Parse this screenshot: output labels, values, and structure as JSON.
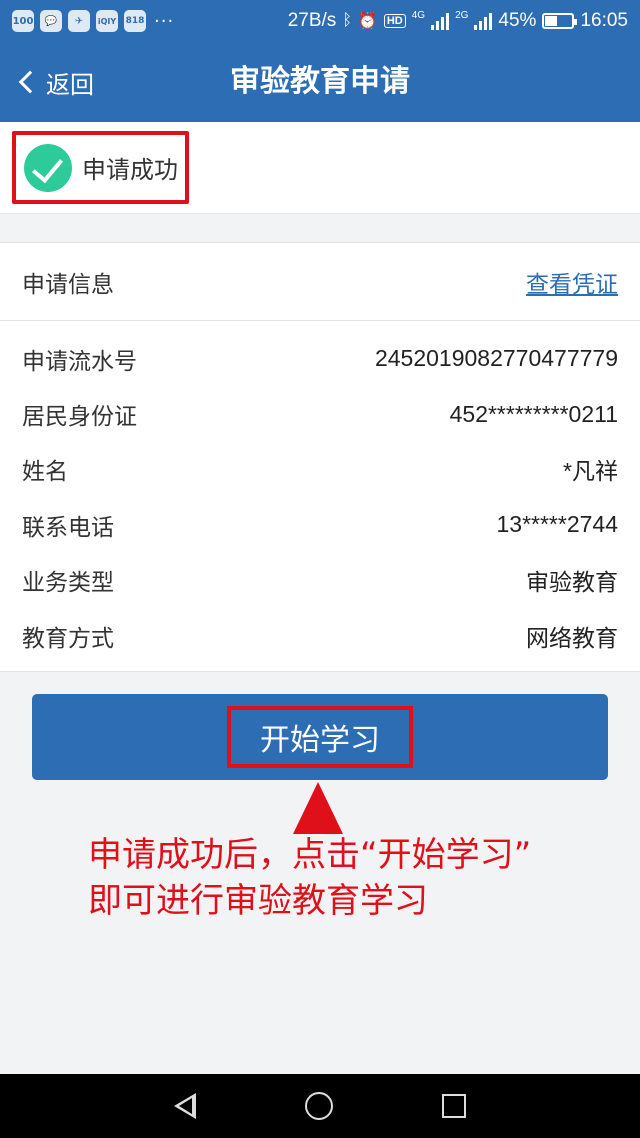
{
  "status_bar": {
    "apps": [
      "100",
      "💬",
      "✈",
      "iQIY",
      "818"
    ],
    "more": "···",
    "net_speed": "27B/s",
    "hd": "HD",
    "net1": "4G",
    "net2": "2G",
    "battery": "45%",
    "battery_level": 0.45,
    "time": "16:05"
  },
  "nav": {
    "back_label": "返回",
    "title": "审验教育申请"
  },
  "success": {
    "text": "申请成功"
  },
  "info": {
    "title": "申请信息",
    "view_link": "查看凭证",
    "rows": [
      {
        "label": "申请流水号",
        "value": "2452019082770477779"
      },
      {
        "label": "居民身份证",
        "value": "452*********0211"
      },
      {
        "label": "姓名",
        "value": "*凡祥"
      },
      {
        "label": "联系电话",
        "value": "13*****2744"
      },
      {
        "label": "业务类型",
        "value": "审验教育"
      },
      {
        "label": "教育方式",
        "value": "网络教育"
      }
    ]
  },
  "start_button": {
    "label": "开始学习"
  },
  "annotation": {
    "line1": "申请成功后，点击“开始学习”",
    "line2": "即可进行审验教育学习"
  },
  "colors": {
    "primary": "#2d6db4",
    "highlight": "#e0101a",
    "success": "#2ecb9a"
  }
}
